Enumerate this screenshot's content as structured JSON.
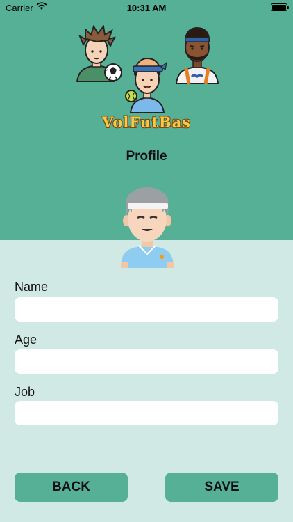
{
  "status_bar": {
    "carrier": "Carrier",
    "time": "10:31 AM",
    "wifi_icon": "wifi-icon",
    "battery_icon": "battery-icon"
  },
  "header": {
    "logo_text": "VolFutBas",
    "title": "Profile",
    "avatars": [
      "football-player-avatar",
      "volleyball-player-avatar",
      "basketball-player-avatar"
    ]
  },
  "profile": {
    "avatar": "profile-avatar"
  },
  "form": {
    "name_label": "Name",
    "name_value": "",
    "age_label": "Age",
    "age_value": "",
    "job_label": "Job",
    "job_value": ""
  },
  "buttons": {
    "back_label": "BACK",
    "save_label": "SAVE"
  },
  "colors": {
    "header_bg": "#55b095",
    "body_bg": "#d1e9e4",
    "button_bg": "#55b095",
    "logo_gold": "#f5c94a"
  }
}
